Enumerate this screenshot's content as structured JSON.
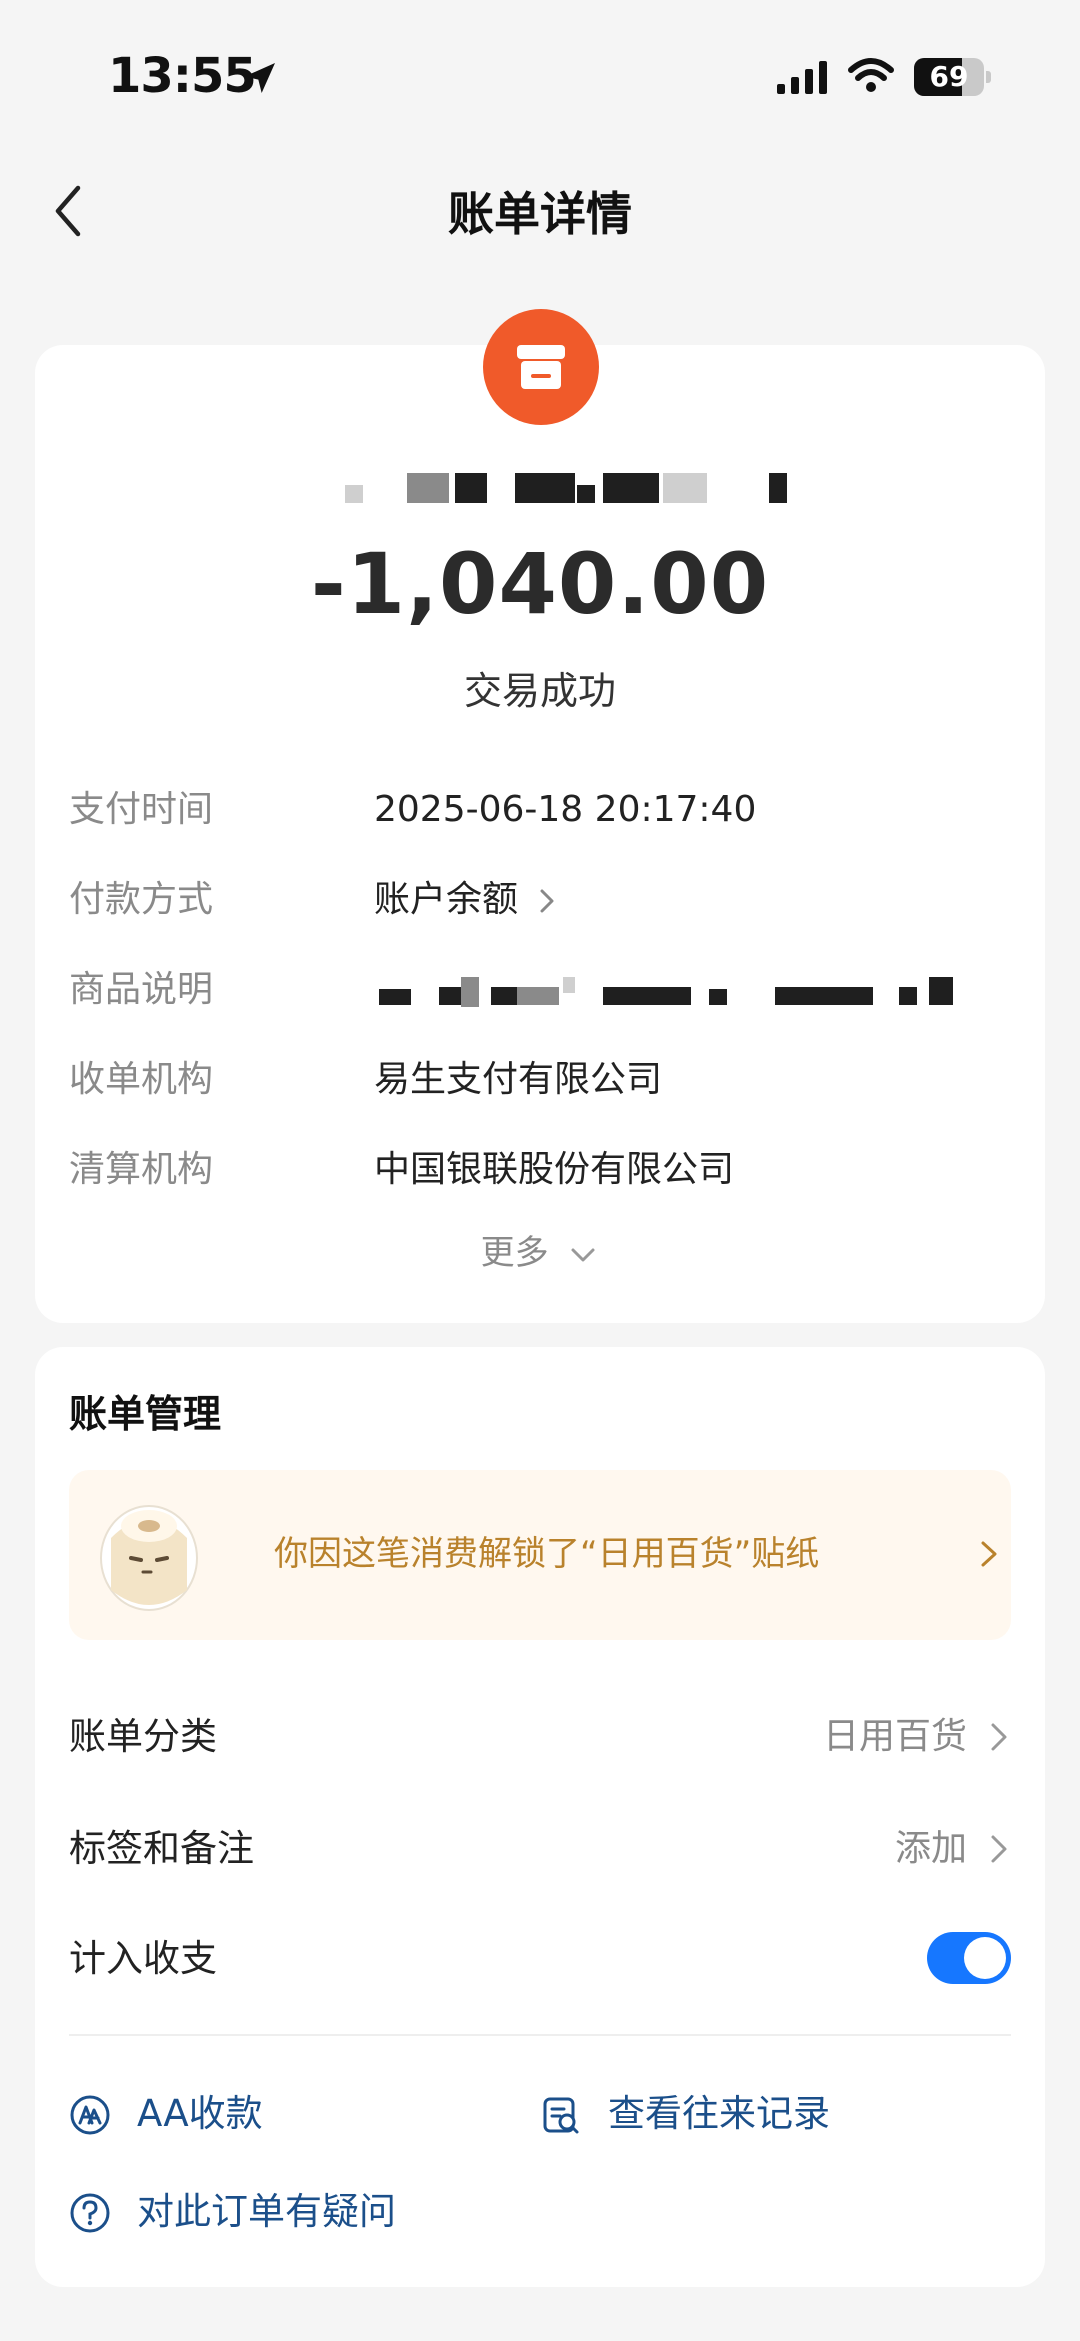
{
  "status_bar": {
    "time": "13:55",
    "battery_level": 69,
    "battery_text": "69"
  },
  "nav": {
    "title": "账单详情"
  },
  "transaction": {
    "amount": "-1,040.00",
    "status": "交易成功",
    "details": [
      {
        "label": "支付时间",
        "value": "2025-06-18 20:17:40"
      },
      {
        "label": "付款方式",
        "value": "账户余额"
      },
      {
        "label": "商品说明",
        "value": ""
      },
      {
        "label": "收单机构",
        "value": "易生支付有限公司"
      },
      {
        "label": "清算机构",
        "value": "中国银联股份有限公司"
      }
    ],
    "more_label": "更多"
  },
  "management": {
    "title": "账单管理",
    "promo_text": "你因这笔消费解锁了“日用百货”贴纸",
    "rows": [
      {
        "label": "账单分类",
        "value": "日用百货"
      },
      {
        "label": "标签和备注",
        "value": "添加"
      },
      {
        "label": "计入收支",
        "toggle_on": true
      }
    ],
    "actions": [
      {
        "label": "AA收款",
        "icon": "aa-icon"
      },
      {
        "label": "查看往来记录",
        "icon": "records-search-icon"
      },
      {
        "label": "对此订单有疑问",
        "icon": "question-icon"
      }
    ]
  },
  "colors": {
    "accent": "#1677ff",
    "merchant_logo": "#f05a2a",
    "promo_text": "#b9822c",
    "action_text": "#1b4f8a"
  }
}
